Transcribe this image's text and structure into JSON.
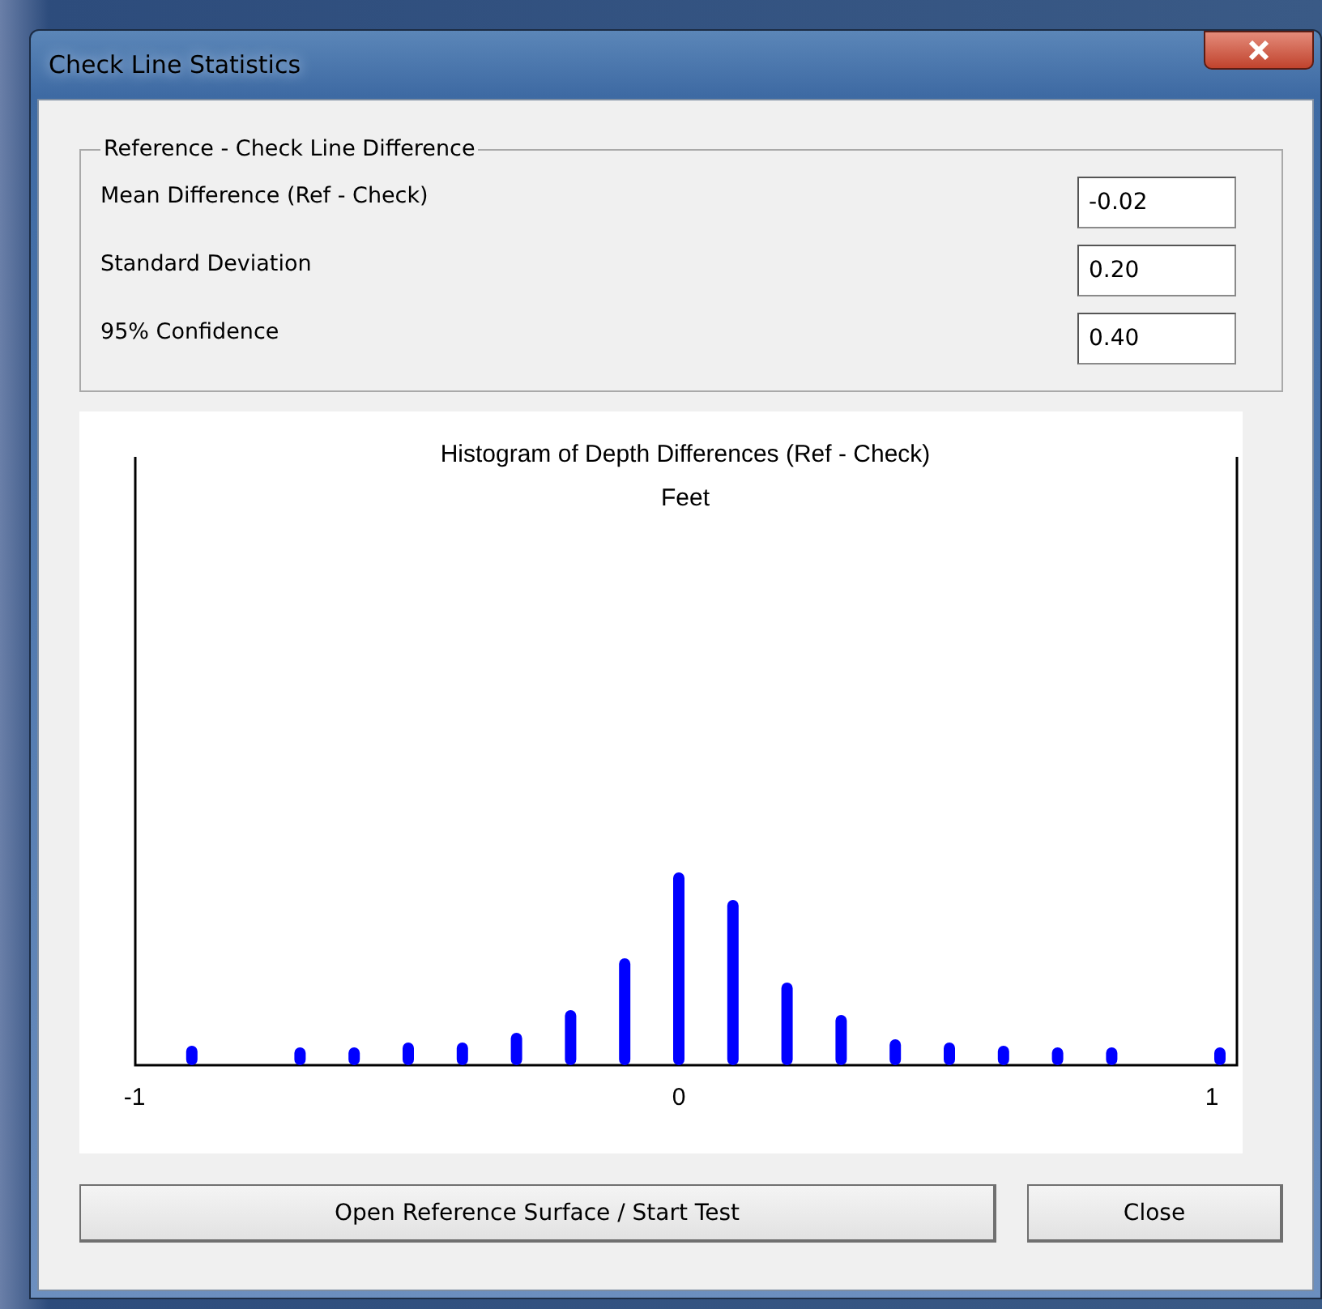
{
  "window": {
    "title": "Check Line Statistics"
  },
  "group": {
    "title": "Reference - Check Line Difference",
    "fields": [
      {
        "label": "Mean Difference (Ref - Check)",
        "value": "-0.02"
      },
      {
        "label": "Standard Deviation",
        "value": "0.20"
      },
      {
        "label": "95% Confidence",
        "value": "0.40"
      }
    ]
  },
  "histogram": {
    "title": "Histogram of Depth Differences (Ref - Check)",
    "subtitle": "Feet",
    "tick_labels": [
      "-1",
      "0",
      "1"
    ]
  },
  "buttons": [
    "Open Reference Surface / Start Test",
    "Close"
  ]
}
